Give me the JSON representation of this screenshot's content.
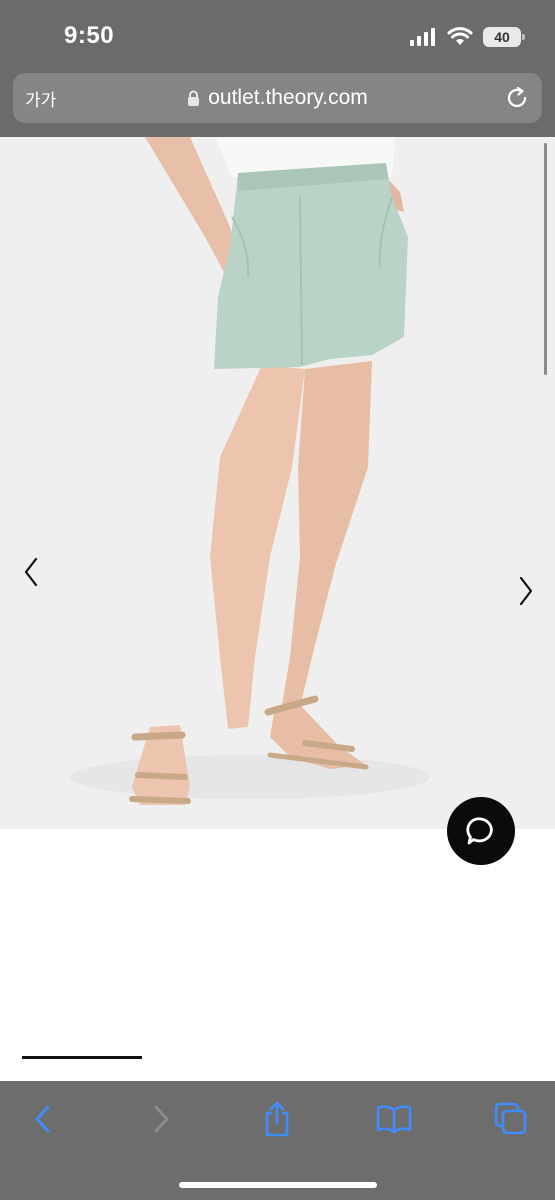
{
  "status_bar": {
    "time": "9:50",
    "battery": "40",
    "icons": [
      "signal-icon",
      "wifi-icon",
      "battery-icon"
    ]
  },
  "address_bar": {
    "text_size_label": "가가",
    "url": "outlet.theory.com",
    "icons": [
      "lock-icon",
      "reload-icon"
    ]
  },
  "product_gallery": {
    "image": "model-wearing-mint-green-shorts-and-sandals",
    "prev_icon": "chevron-left-icon",
    "next_icon": "chevron-right-icon"
  },
  "chat": {
    "icon": "chat-bubble-icon"
  },
  "toolbar": {
    "icons": [
      "back-icon",
      "forward-icon",
      "share-icon",
      "bookmarks-icon",
      "tabs-icon"
    ],
    "accent_color": "#3f8cff"
  },
  "colors": {
    "chrome_gray": "#6b6b6b",
    "shorts_mint": "#b9d3c7",
    "background": "#efefef"
  }
}
